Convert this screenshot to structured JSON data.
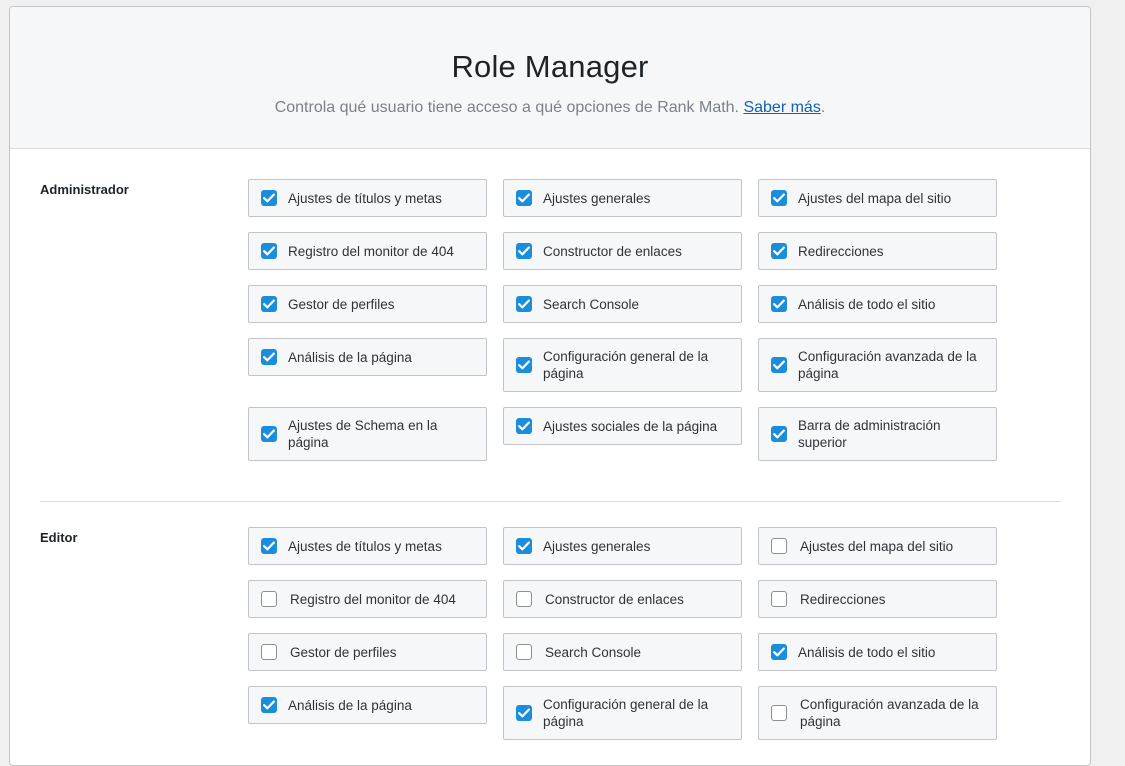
{
  "header": {
    "title": "Role Manager",
    "description": "Controla qué usuario tiene acceso a qué opciones de Rank Math. ",
    "learn_more": "Saber más",
    "period": "."
  },
  "colors": {
    "accent": "#1a8ddb",
    "link": "#0f62b0"
  },
  "roles": [
    {
      "name": "Administrador",
      "capabilities": [
        {
          "label": "Ajustes de títulos y metas",
          "checked": true,
          "tall": false
        },
        {
          "label": "Ajustes generales",
          "checked": true,
          "tall": false
        },
        {
          "label": "Ajustes del mapa del sitio",
          "checked": true,
          "tall": false
        },
        {
          "label": "Registro del monitor de 404",
          "checked": true,
          "tall": false
        },
        {
          "label": "Constructor de enlaces",
          "checked": true,
          "tall": false
        },
        {
          "label": "Redirecciones",
          "checked": true,
          "tall": false
        },
        {
          "label": "Gestor de perfiles",
          "checked": true,
          "tall": false
        },
        {
          "label": "Search Console",
          "checked": true,
          "tall": false
        },
        {
          "label": "Análisis de todo el sitio",
          "checked": true,
          "tall": false
        },
        {
          "label": "Análisis de la página",
          "checked": true,
          "tall": false
        },
        {
          "label": "Configuración general de la página",
          "checked": true,
          "tall": true
        },
        {
          "label": "Configuración avanzada de la página",
          "checked": true,
          "tall": true
        },
        {
          "label": "Ajustes de Schema en la página",
          "checked": true,
          "tall": true
        },
        {
          "label": "Ajustes sociales de la página",
          "checked": true,
          "tall": false
        },
        {
          "label": "Barra de administración superior",
          "checked": true,
          "tall": true
        }
      ]
    },
    {
      "name": "Editor",
      "capabilities": [
        {
          "label": "Ajustes de títulos y metas",
          "checked": true,
          "tall": false
        },
        {
          "label": "Ajustes generales",
          "checked": true,
          "tall": false
        },
        {
          "label": "Ajustes del mapa del sitio",
          "checked": false,
          "tall": false
        },
        {
          "label": "Registro del monitor de 404",
          "checked": false,
          "tall": false
        },
        {
          "label": "Constructor de enlaces",
          "checked": false,
          "tall": false
        },
        {
          "label": "Redirecciones",
          "checked": false,
          "tall": false
        },
        {
          "label": "Gestor de perfiles",
          "checked": false,
          "tall": false
        },
        {
          "label": "Search Console",
          "checked": false,
          "tall": false
        },
        {
          "label": "Análisis de todo el sitio",
          "checked": true,
          "tall": false
        },
        {
          "label": "Análisis de la página",
          "checked": true,
          "tall": false
        },
        {
          "label": "Configuración general de la página",
          "checked": true,
          "tall": true
        },
        {
          "label": "Configuración avanzada de la página",
          "checked": false,
          "tall": true
        }
      ]
    }
  ]
}
